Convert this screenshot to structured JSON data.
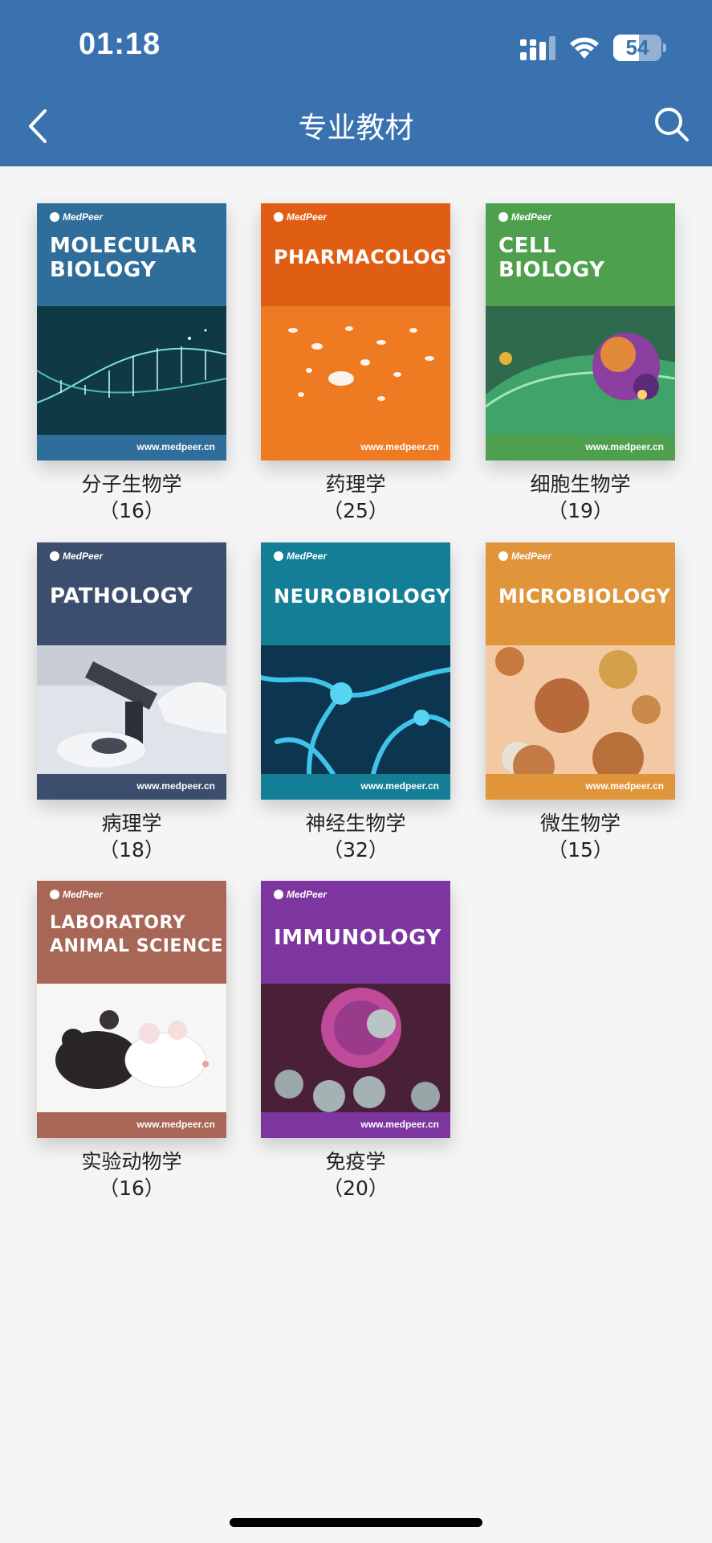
{
  "status_bar": {
    "time": "01:18",
    "battery": "54",
    "battery_level": 0.54
  },
  "header": {
    "title": "专业教材"
  },
  "books": [
    {
      "name": "分子生物学",
      "count": "（16）",
      "cover_line1": "MOLECULAR",
      "cover_line2": "BIOLOGY",
      "brand": "MedPeer",
      "url": "www.medpeer.cn",
      "color": "#2f6e9a"
    },
    {
      "name": "药理学",
      "count": "（25）",
      "cover_line1": "PHARMACOLOGY",
      "cover_line2": "",
      "brand": "MedPeer",
      "url": "www.medpeer.cn",
      "color": "#e56a1d"
    },
    {
      "name": "细胞生物学",
      "count": "（19）",
      "cover_line1": "CELL",
      "cover_line2": "BIOLOGY",
      "brand": "MedPeer",
      "url": "www.medpeer.cn",
      "color": "#4ea04f"
    },
    {
      "name": "病理学",
      "count": "（18）",
      "cover_line1": "PATHOLOGY",
      "cover_line2": "",
      "brand": "MedPeer",
      "url": "www.medpeer.cn",
      "color": "#3c4e6d"
    },
    {
      "name": "神经生物学",
      "count": "（32）",
      "cover_line1": "NEUROBIOLOGY",
      "cover_line2": "",
      "brand": "MedPeer",
      "url": "www.medpeer.cn",
      "color": "#137e96"
    },
    {
      "name": "微生物学",
      "count": "（15）",
      "cover_line1": "MICROBIOLOGY",
      "cover_line2": "",
      "brand": "MedPeer",
      "url": "www.medpeer.cn",
      "color": "#e0953b"
    },
    {
      "name": "实验动物学",
      "count": "（16）",
      "cover_line1": "LABORATORY",
      "cover_line2": "ANIMAL SCIENCE",
      "brand": "MedPeer",
      "url": "www.medpeer.cn",
      "color": "#a86656"
    },
    {
      "name": "免疫学",
      "count": "（20）",
      "cover_line1": "IMMUNOLOGY",
      "cover_line2": "",
      "brand": "MedPeer",
      "url": "www.medpeer.cn",
      "color": "#7d36a0"
    }
  ]
}
